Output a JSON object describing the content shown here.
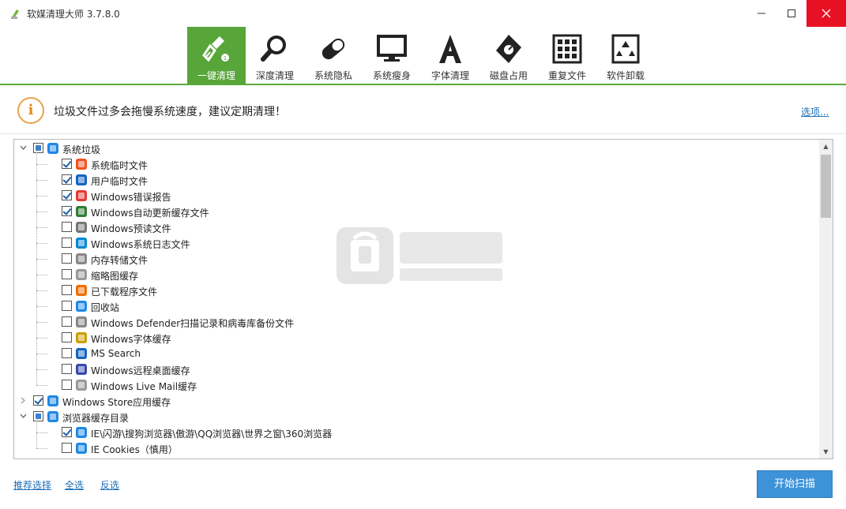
{
  "window": {
    "title": "软媒清理大师 3.7.8.0",
    "min_icon": "minimize-icon",
    "max_icon": "maximize-icon",
    "close_icon": "close-icon"
  },
  "toolbar": {
    "accent": "#58a63a",
    "tools": [
      {
        "label": "一键清理",
        "icon": "broom-icon",
        "active": true
      },
      {
        "label": "深度清理",
        "icon": "magnifier-icon",
        "active": false
      },
      {
        "label": "系统隐私",
        "icon": "pill-icon",
        "active": false
      },
      {
        "label": "系统瘦身",
        "icon": "monitor-icon",
        "active": false
      },
      {
        "label": "字体清理",
        "icon": "font-a-icon",
        "active": false
      },
      {
        "label": "磁盘占用",
        "icon": "disk-tag-icon",
        "active": false
      },
      {
        "label": "重复文件",
        "icon": "duplicate-grid-icon",
        "active": false
      },
      {
        "label": "软件卸载",
        "icon": "recycle-bin-icon",
        "active": false
      }
    ]
  },
  "info": {
    "icon": "info-i-icon",
    "glyph": "i",
    "message": "垃圾文件过多会拖慢系统速度，建议定期清理！",
    "options_link": "选项..."
  },
  "tree": {
    "items": [
      {
        "label": "系统垃圾",
        "level": 0,
        "state": "partial",
        "expander": "expanded",
        "icon": "windows-logo-icon"
      },
      {
        "label": "系统临时文件",
        "level": 1,
        "state": "checked",
        "icon": "windows-flag-icon"
      },
      {
        "label": "用户临时文件",
        "level": 1,
        "state": "checked",
        "icon": "user-icon"
      },
      {
        "label": "Windows错误报告",
        "level": 1,
        "state": "checked",
        "icon": "error-report-icon"
      },
      {
        "label": "Windows自动更新缓存文件",
        "level": 1,
        "state": "checked",
        "icon": "update-globe-icon"
      },
      {
        "label": "Windows预读文件",
        "level": 1,
        "state": "unchecked",
        "icon": "prefetch-icon"
      },
      {
        "label": "Windows系统日志文件",
        "level": 1,
        "state": "unchecked",
        "icon": "log-file-icon"
      },
      {
        "label": "内存转储文件",
        "level": 1,
        "state": "unchecked",
        "icon": "memory-dump-icon"
      },
      {
        "label": "缩略图缓存",
        "level": 1,
        "state": "unchecked",
        "icon": "thumbnail-icon"
      },
      {
        "label": "已下载程序文件",
        "level": 1,
        "state": "unchecked",
        "icon": "download-icon"
      },
      {
        "label": "回收站",
        "level": 1,
        "state": "unchecked",
        "icon": "recycle-icon"
      },
      {
        "label": "Windows Defender扫描记录和病毒库备份文件",
        "level": 1,
        "state": "unchecked",
        "icon": "defender-castle-icon"
      },
      {
        "label": "Windows字体缓存",
        "level": 1,
        "state": "unchecked",
        "icon": "font-cache-icon"
      },
      {
        "label": "MS Search",
        "level": 1,
        "state": "unchecked",
        "icon": "search-icon"
      },
      {
        "label": "Windows远程桌面缓存",
        "level": 1,
        "state": "unchecked",
        "icon": "remote-desktop-icon"
      },
      {
        "label": "Windows Live Mail缓存",
        "level": 1,
        "state": "unchecked",
        "icon": "mail-icon"
      },
      {
        "label": "Windows Store应用缓存",
        "level": 0,
        "state": "checked",
        "expander": "collapsed",
        "icon": "store-icon"
      },
      {
        "label": "浏览器缓存目录",
        "level": 0,
        "state": "partial",
        "expander": "expanded",
        "icon": "ie-icon"
      },
      {
        "label": "IE\\闪游\\搜狗浏览器\\傲游\\QQ浏览器\\世界之窗\\360浏览器",
        "level": 1,
        "state": "checked",
        "icon": "ie-icon"
      },
      {
        "label": "IE Cookies（慎用）",
        "level": 1,
        "state": "unchecked",
        "icon": "ie-icon"
      }
    ]
  },
  "scrollbar": {
    "up_glyph": "▲",
    "down_glyph": "▼"
  },
  "bottom": {
    "recommend": "推荐选择",
    "select_all": "全选",
    "invert": "反选",
    "scan_button": "开始扫描"
  }
}
